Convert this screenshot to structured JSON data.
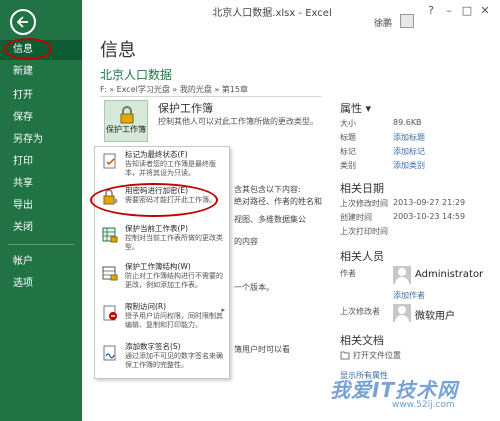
{
  "window": {
    "title": "北京人口数据.xlsx - Excel",
    "controls": [
      "?",
      "–",
      "□",
      "✕"
    ],
    "user": "徐鹏"
  },
  "nav": {
    "items": [
      {
        "label": "信息",
        "active": true
      },
      {
        "label": "新建"
      },
      {
        "label": "打开"
      },
      {
        "label": "保存"
      },
      {
        "label": "另存为"
      },
      {
        "label": "打印"
      },
      {
        "label": "共享"
      },
      {
        "label": "导出"
      },
      {
        "label": "关闭"
      },
      {
        "label": "帐户"
      },
      {
        "label": "选项"
      }
    ]
  },
  "main": {
    "heading": "信息",
    "filename": "北京人口数据",
    "path": "F: » Excel学习光盘 » 我的光盘 » 第15章",
    "protect": {
      "button_label": "保护工作簿",
      "title": "保护工作簿",
      "desc": "控制其他人可以对此工作簿所做的更改类型。"
    },
    "background_text": [
      "含其包含以下内容:",
      "绝对路径、作者的姓名和",
      "视图、多维数据集公",
      "的内容",
      "一个版本。",
      "簿用户时可以看"
    ]
  },
  "menu": {
    "items": [
      {
        "title": "标记为最终状态(F)",
        "desc": "告知读者您的工作簿是最终版本，并将其设为只读。"
      },
      {
        "title": "用密码进行加密(E)",
        "desc": "需要密码才能打开此工作簿。"
      },
      {
        "title": "保护当前工作表(P)",
        "desc": "控制对当前工作表所做的更改类型。"
      },
      {
        "title": "保护工作簿结构(W)",
        "desc": "防止对工作簿结构进行不需要的更改，例如添加工作表。"
      },
      {
        "title": "限制访问(R)",
        "desc": "授予用户访问权限，同时限制其编辑、复制和打印能力。",
        "submenu": true
      },
      {
        "title": "添加数字签名(S)",
        "desc": "通过添加不可见的数字签名来确保工作簿的完整性。"
      }
    ]
  },
  "properties": {
    "heading": "属性 ▾",
    "rows": [
      {
        "key": "大小",
        "value": "89.6KB",
        "link": false
      },
      {
        "key": "标题",
        "value": "添加标题",
        "link": true
      },
      {
        "key": "标记",
        "value": "添加标记",
        "link": true
      },
      {
        "key": "类别",
        "value": "添加类别",
        "link": true
      }
    ],
    "dates_heading": "相关日期",
    "dates": [
      {
        "key": "上次修改时间",
        "value": "2013-09-27 21:29"
      },
      {
        "key": "创建时间",
        "value": "2003-10-23 14:59"
      },
      {
        "key": "上次打印时间",
        "value": ""
      }
    ],
    "people_heading": "相关人员",
    "author_key": "作者",
    "author": "Administrator",
    "add_author": "添加作者",
    "modifier_key": "上次修改者",
    "modifier": "微软用户",
    "docs_heading": "相关文档",
    "open_location": "打开文件位置",
    "show_all": "显示所有属性"
  },
  "watermark": {
    "text": "我爱IT技术网",
    "sub": "www.52ij.com"
  }
}
